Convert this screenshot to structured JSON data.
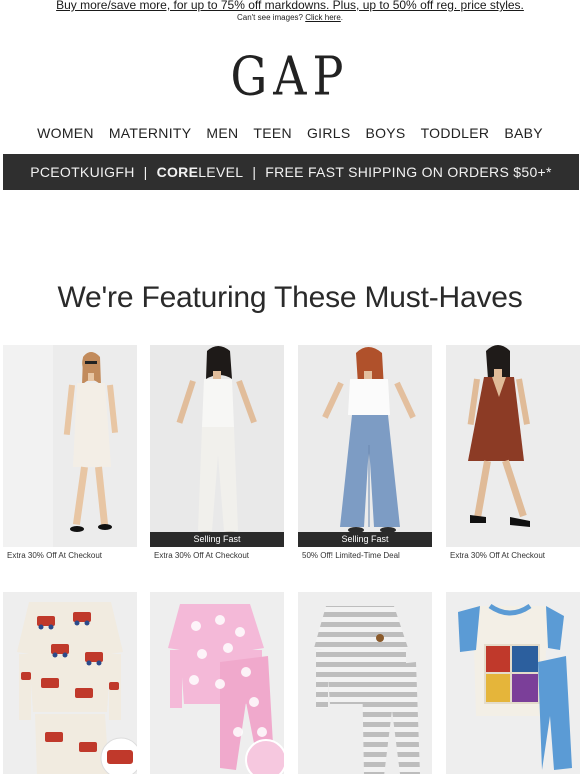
{
  "promo": {
    "headline": "Buy more/save more, for up to 75% off markdowns. Plus, up to 50% off reg. price styles.",
    "cant_see_text": "Can't see images?",
    "click_here": "Click here",
    "click_here_period": "."
  },
  "logo": {
    "text": "GAP"
  },
  "nav": {
    "items": [
      {
        "label": "WOMEN"
      },
      {
        "label": "MATERNITY"
      },
      {
        "label": "MEN"
      },
      {
        "label": "TEEN"
      },
      {
        "label": "GIRLS"
      },
      {
        "label": "BOYS"
      },
      {
        "label": "TODDLER"
      },
      {
        "label": "BABY"
      }
    ]
  },
  "account_bar": {
    "member_id": "PCEOTKUIGFH",
    "separator": "|",
    "level_bold": "CORE",
    "level_rest": " LEVEL",
    "shipping": "FREE FAST SHIPPING ON ORDERS $50+*"
  },
  "section": {
    "heading": "We're Featuring These Must-Haves"
  },
  "products": [
    {
      "caption": "Extra 30% Off At Checkout",
      "badge": "",
      "outfit": "white slip dress",
      "bg": "#ececec",
      "garment": "#f3eee6"
    },
    {
      "caption": "Extra 30% Off At Checkout",
      "badge": "Selling Fast",
      "outfit": "white tank and white jeans",
      "bg": "#e9e9e9",
      "garment": "#f7f7f5"
    },
    {
      "caption": "50% Off! Limited-Time Deal",
      "badge": "Selling Fast",
      "outfit": "white tee and wide-leg jeans",
      "bg": "#ebebeb",
      "garment": "#7d9cc4"
    },
    {
      "caption": "Extra 30% Off At Checkout",
      "badge": "",
      "outfit": "rust v-neck dress",
      "bg": "#ececec",
      "garment": "#8c3b25"
    }
  ],
  "kids_products": [
    {
      "pattern": "fire-truck print pajamas",
      "color": "#f1ebe0",
      "accent": "#c0392b"
    },
    {
      "pattern": "pink heart pajamas",
      "color": "#f4b9d8",
      "accent": "#ffffff"
    },
    {
      "pattern": "grey striped pajamas",
      "color": "#cfcfcf",
      "accent": "#f2f2f2"
    },
    {
      "pattern": "superhero print pajamas",
      "color": "#f3efe6",
      "accent": "#5b9bd5"
    }
  ],
  "colors": {
    "account_bar": "#2f2f2f",
    "badge": "#2b2b2b",
    "text": "#222222"
  }
}
